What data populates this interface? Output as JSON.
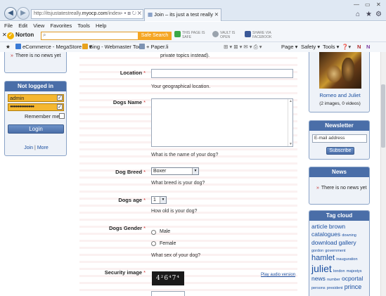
{
  "browser": {
    "address_prefix": "http://itsjustatestreally.",
    "address_domain": "myocp.com",
    "address_suffix": "/index",
    "tab_title": "Join – its just a test really",
    "menu": [
      "File",
      "Edit",
      "View",
      "Favorites",
      "Tools",
      "Help"
    ],
    "norton": {
      "logo": "Norton",
      "safe_search_label": "Safe Search",
      "badge_safe_line1": "THIS PAGE IS",
      "badge_safe_line2": "SAFE",
      "badge_vault_line1": "VAULT IS",
      "badge_vault_line2": "OPEN",
      "badge_share_line1": "SHARE VIA",
      "badge_share_line2": "FACEBOOK"
    },
    "favorites": {
      "item1": "eCommerce - MegaStore ...",
      "item2": "Bing - Webmaster Tools",
      "item3": "Paper.li"
    },
    "commands": {
      "page": "Page",
      "safety": "Safety",
      "tools": "Tools"
    }
  },
  "left": {
    "news_text": "There is no news yet",
    "login": {
      "title": "Not logged in",
      "username": "admin",
      "password_mask": "●●●●●●●●●●●●●",
      "remember_label": "Remember me",
      "login_button": "Login",
      "link_join": "Join",
      "link_more": "More",
      "link_sep": "|"
    }
  },
  "form": {
    "top_note": "private topics instead).",
    "location_label": "Location",
    "location_help": "Your geographical location.",
    "dogs_name_label": "Dogs Name",
    "dogs_name_help": "What is the name of your dog?",
    "dog_breed_label": "Dog Breed",
    "dog_breed_value": "Boxer",
    "dog_breed_help": "What breed is your dog?",
    "dogs_age_label": "Dogs age",
    "dogs_age_value": "1",
    "dogs_age_help": "How old is your dog?",
    "dogs_gender_label": "Dogs Gender",
    "gender_male": "Male",
    "gender_female": "Female",
    "dogs_gender_help": "What sex of your dog?",
    "security_label": "Security image",
    "captcha_text": "4²6⁴7⁴",
    "audio_link": "Play audio version",
    "required_mark": "*"
  },
  "right": {
    "gallery_caption": "Romeo and Juliet",
    "gallery_count": "(2 images, 0 videos)",
    "newsletter_title": "Newsletter",
    "newsletter_placeholder": "E-mail address",
    "subscribe_button": "Subscribe",
    "news_title": "News",
    "news_text": "There is no news yet",
    "tagcloud_title": "Tag cloud",
    "tags": {
      "t1": "article",
      "t2": "brown",
      "t3": "catalogues",
      "t4": "downing",
      "t5": "download",
      "t6": "gallery",
      "t7": "gordon",
      "t8": "government",
      "t9": "hamlet",
      "t10": "inauguration",
      "t11": "juliet",
      "t12": "london",
      "t13": "majestys",
      "t14": "news",
      "t15": "number",
      "t16": "ocportal",
      "t17": "persons",
      "t18": "president",
      "t19": "prince"
    }
  },
  "colors": {
    "panel_header": "#4a6ea8",
    "link": "#1a4fa0",
    "required": "#d03030",
    "login_field": "#f5b730"
  }
}
